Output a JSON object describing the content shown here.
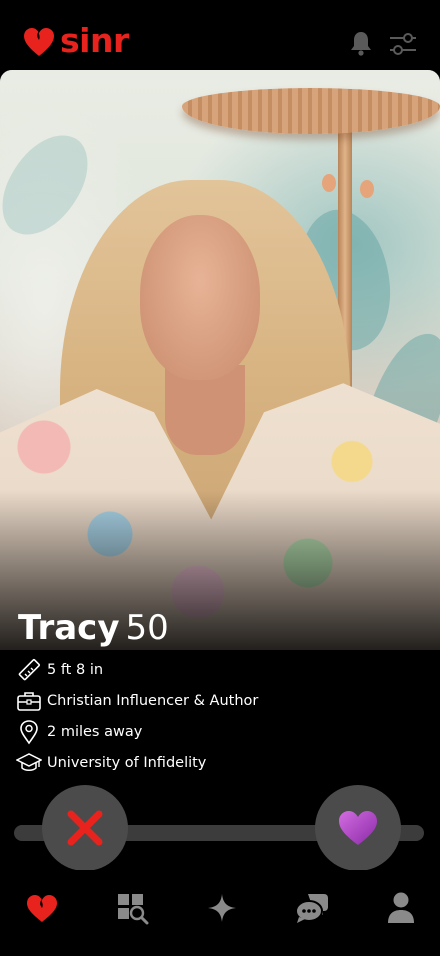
{
  "app": {
    "brand_name": "sinr",
    "brand_color": "#e8231d"
  },
  "header": {
    "notifications_icon": "bell-icon",
    "filters_icon": "sliders-icon"
  },
  "profile": {
    "name": "Tracy",
    "age": "50",
    "details": [
      {
        "icon": "ruler-icon",
        "text": "5 ft 8 in"
      },
      {
        "icon": "briefcase-icon",
        "text": "Christian Influencer & Author"
      },
      {
        "icon": "location-pin-icon",
        "text": "2 miles away"
      },
      {
        "icon": "graduation-cap-icon",
        "text": "University of Infidelity"
      }
    ]
  },
  "actions": {
    "nope_icon": "x-icon",
    "nope_color": "#e8231d",
    "like_icon": "heart-icon",
    "like_color": "#b04bc9"
  },
  "bottom_nav": {
    "items": [
      {
        "icon": "heart-icon",
        "active": true
      },
      {
        "icon": "grid-search-icon",
        "active": false
      },
      {
        "icon": "sparkle-icon",
        "active": false
      },
      {
        "icon": "chat-bubbles-icon",
        "active": false
      },
      {
        "icon": "profile-icon",
        "active": false
      }
    ],
    "inactive_color": "#8a8a8a"
  }
}
